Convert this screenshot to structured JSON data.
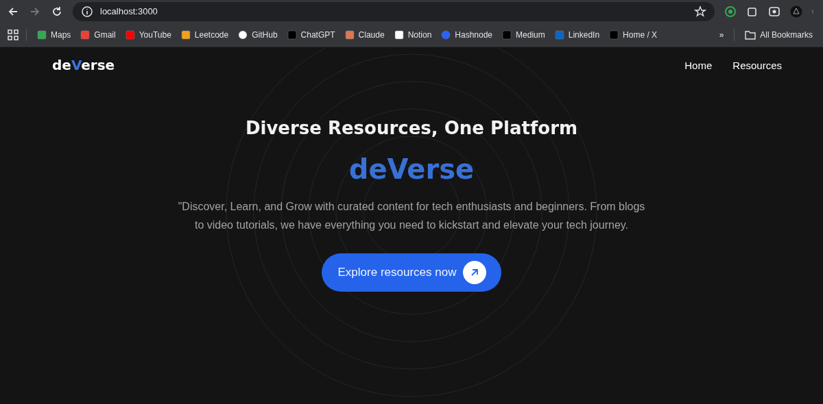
{
  "browser": {
    "address": "localhost:3000",
    "bookmarks": [
      {
        "label": "Maps"
      },
      {
        "label": "Gmail"
      },
      {
        "label": "YouTube"
      },
      {
        "label": "Leetcode"
      },
      {
        "label": "GitHub"
      },
      {
        "label": "ChatGPT"
      },
      {
        "label": "Claude"
      },
      {
        "label": "Notion"
      },
      {
        "label": "Hashnode"
      },
      {
        "label": "Medium"
      },
      {
        "label": "LinkedIn"
      },
      {
        "label": "Home / X"
      }
    ],
    "overflow": "»",
    "all_bookmarks": "All Bookmarks"
  },
  "navbar": {
    "logo": [
      {
        "text": "de",
        "accent": false
      },
      {
        "text": "V",
        "accent": true
      },
      {
        "text": "erse",
        "accent": false
      }
    ],
    "links": [
      "Home",
      "Resources"
    ]
  },
  "hero": {
    "heading": "Diverse Resources, One Platform",
    "brand": "deVerse",
    "description": "\"Discover, Learn, and Grow with curated content for tech enthusiasts and beginners. From blogs to video tutorials, we have everything you need to kickstart and elevate your tech journey.",
    "cta": "Explore resources now"
  }
}
